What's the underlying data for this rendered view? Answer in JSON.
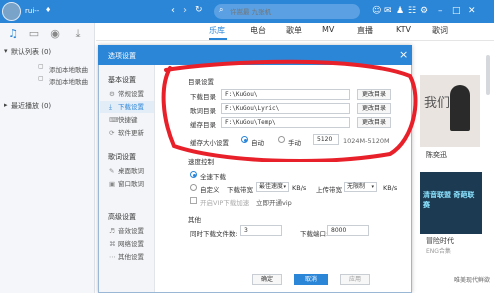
{
  "topbar": {
    "username": "rui--",
    "search_placeholder": "许嵩最 九张机",
    "icons": [
      "back-icon",
      "forward-icon",
      "refresh-icon",
      "search-icon",
      "user-icon",
      "mail-icon",
      "shirt-icon",
      "game-icon",
      "settings-icon",
      "minimize-icon",
      "maximize-icon",
      "close-icon"
    ]
  },
  "leftnav": {
    "default_list": "默认列表 (0)",
    "items": [
      "添加本地歌曲",
      "添加本地歌曲"
    ],
    "recent": "最近播放 (0)"
  },
  "tabs": [
    "乐库",
    "电台",
    "歌单",
    "MV",
    "直播",
    "KTV",
    "歌词"
  ],
  "active_tab": "乐库",
  "right_panel": {
    "card1_title": "我们",
    "card1_artist": "陈奕迅",
    "card2_banner": "清音联盟 奇葩联赛",
    "card2_title": "冒险时代",
    "card2_sub": "ENG合集",
    "footer_right": "唯美现代鲜欲"
  },
  "dialog": {
    "title": "选项设置",
    "side": {
      "basic_head": "基本设置",
      "basic_items": [
        "常规设置",
        "下载设置",
        "快捷键",
        "软件更新"
      ],
      "lyrics_head": "歌词设置",
      "lyrics_items": [
        "桌面歌词",
        "窗口歌词"
      ],
      "advanced_head": "高级设置",
      "advanced_items": [
        "音效设置",
        "网络设置",
        "其他设置"
      ]
    },
    "active_item": "下载设置",
    "dirs": {
      "title": "目录设置",
      "rows": [
        {
          "label": "下载目录",
          "value": "F:\\KuGou\\",
          "button": "更改目录"
        },
        {
          "label": "歌词目录",
          "value": "F:\\KuGou\\Lyric\\",
          "button": "更改目录"
        },
        {
          "label": "缓存目录",
          "value": "F:\\KuGou\\Temp\\",
          "button": "更改目录"
        }
      ],
      "cache_label": "缓存大小设置",
      "cache_auto": "自动",
      "cache_manual": "手动",
      "cache_value": "5120",
      "cache_range": "1024M-5120M"
    },
    "speed": {
      "title": "速度控制",
      "full": "全速下载",
      "custom": "自定义",
      "dl_label": "下载带宽",
      "dl_value": "最佳速度",
      "dl_unit": "KB/s",
      "ul_label": "上传带宽",
      "ul_value": "无限制",
      "ul_unit": "KB/s",
      "vip_check": "开启VIP下载加速",
      "vip_link": "立即开通vip"
    },
    "other": {
      "title": "其他",
      "concurrent_label": "同时下载文件数:",
      "concurrent_value": "3",
      "port_label": "下载端口:",
      "port_value": "8000"
    },
    "buttons": {
      "ok": "确定",
      "cancel": "取消",
      "apply": "应用"
    }
  },
  "colors": {
    "accent": "#2b86d8",
    "annotation": "#e8202a"
  }
}
